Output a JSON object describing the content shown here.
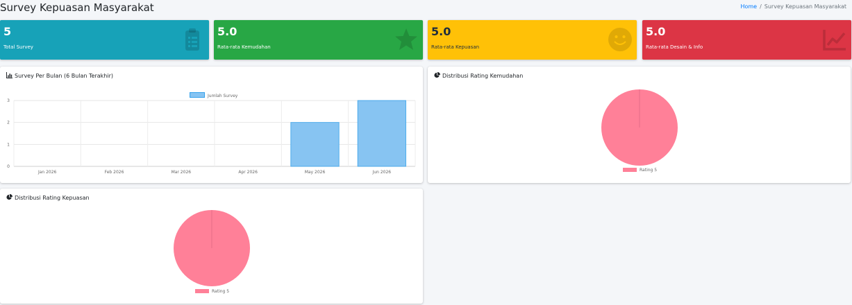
{
  "page": {
    "title": "Survey Kepuasan Masyarakat"
  },
  "breadcrumb": {
    "home": "Home",
    "separator": "/",
    "current": "Survey Kepuasan Masyarakat"
  },
  "stats": [
    {
      "value": "5",
      "label": "Total Survey",
      "icon": "clipboard-list-icon",
      "color": "#17a2b8"
    },
    {
      "value": "5.0",
      "label": "Rata-rata Kemudahan",
      "icon": "star-icon",
      "color": "#28a745"
    },
    {
      "value": "5.0",
      "label": "Rata-rata Kepuasan",
      "icon": "smile-icon",
      "color": "#ffc107"
    },
    {
      "value": "5.0",
      "label": "Rata-rata Desain & Info",
      "icon": "chart-line-icon",
      "color": "#dc3545"
    }
  ],
  "cards": {
    "monthly": {
      "title": "Survey Per Bulan (6 Bulan Terakhir)",
      "icon": "chart-bar-icon"
    },
    "ease": {
      "title": "Distribusi Rating Kemudahan",
      "icon": "chart-pie-icon"
    },
    "satisfaction": {
      "title": "Distribusi Rating Kepuasan",
      "icon": "chart-pie-icon"
    }
  },
  "chart_data": [
    {
      "type": "bar",
      "categories": [
        "Jan 2026",
        "Feb 2026",
        "Mar 2026",
        "Apr 2026",
        "May 2026",
        "Jun 2026"
      ],
      "series": [
        {
          "name": "Jumlah Survey",
          "values": [
            0,
            0,
            0,
            0,
            2,
            3
          ],
          "color": "#87c4f2",
          "border": "#36a2eb"
        }
      ],
      "ylim": [
        0,
        3
      ],
      "yticks": [
        0,
        1,
        2,
        3
      ],
      "grid": true,
      "legend": "top"
    },
    {
      "type": "pie",
      "labels": [
        "Rating 5"
      ],
      "values": [
        100
      ],
      "colors": [
        "#ff8098"
      ],
      "legend": "bottom"
    },
    {
      "type": "pie",
      "labels": [
        "Rating 5"
      ],
      "values": [
        100
      ],
      "colors": [
        "#ff8098"
      ],
      "legend": "bottom"
    }
  ]
}
